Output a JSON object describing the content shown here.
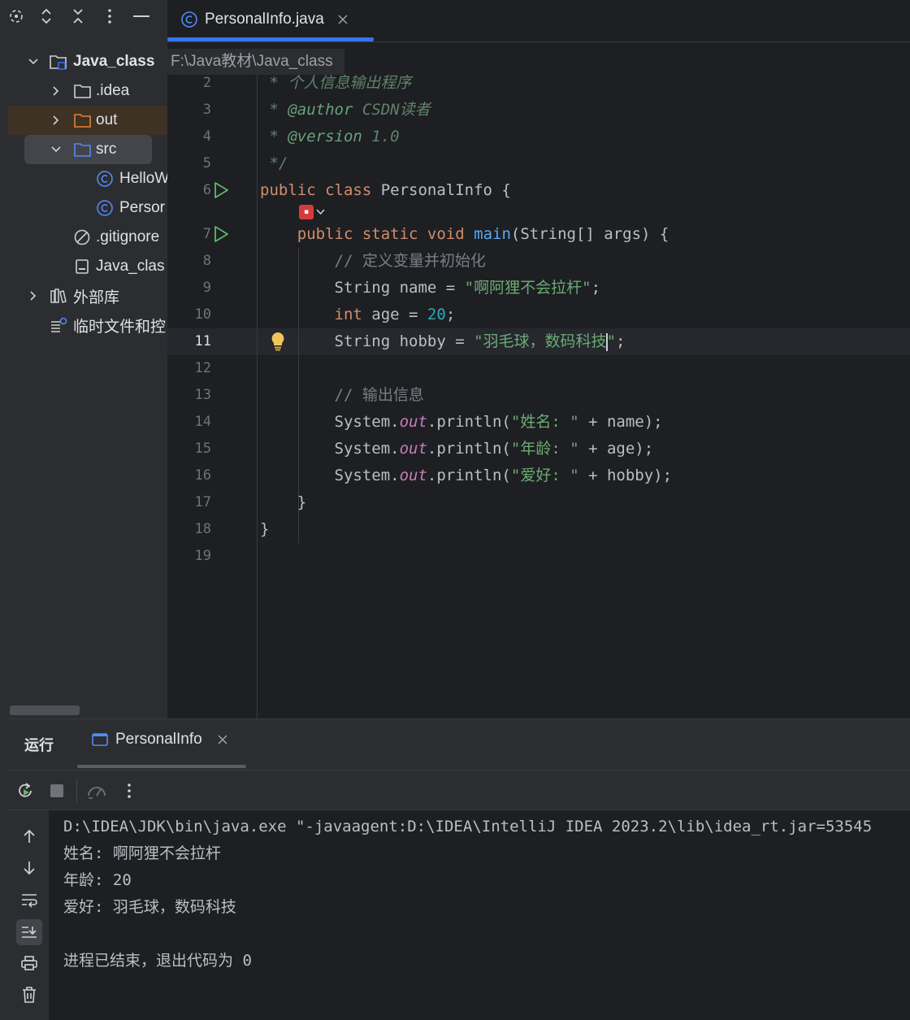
{
  "project": {
    "root_name": "Java_class",
    "root_path": "F:\\Java教材\\Java_class",
    "items": [
      {
        "label": ".idea"
      },
      {
        "label": "out"
      },
      {
        "label": "src"
      },
      {
        "label": "HelloW"
      },
      {
        "label": "Persor"
      },
      {
        "label": ".gitignore"
      },
      {
        "label": "Java_clas"
      },
      {
        "label": "外部库"
      },
      {
        "label": "临时文件和控"
      }
    ]
  },
  "editor": {
    "tab_label": "PersonalInfo.java",
    "line_numbers": [
      "2",
      "3",
      "4",
      "5",
      "6",
      "7",
      "8",
      "9",
      "10",
      "11",
      "12",
      "13",
      "14",
      "15",
      "16",
      "17",
      "18",
      "19"
    ],
    "current_line": "11",
    "code": {
      "l2": " * 个人信息输出程序",
      "l3_star": " * ",
      "l3_tag": "@author",
      "l3_val": " CSDN读者",
      "l4_star": " * ",
      "l4_tag": "@version",
      "l4_val": " 1.0",
      "l5": " */",
      "l6_kw": "public class",
      "l6_rest": " PersonalInfo {",
      "l7_kw": "public static void",
      "l7_fn": "main",
      "l7_rest": "(String[] args) {",
      "l8": "// 定义变量并初始化",
      "l9_pre": "String name = ",
      "l9_str": "\"啊阿狸不会拉杆\"",
      "l9_end": ";",
      "l10_kw": "int",
      "l10_mid": " age = ",
      "l10_num": "20",
      "l10_end": ";",
      "l11_pre": "String hobby = ",
      "l11_str_a": "\"羽毛球，数码科技",
      "l11_str_b": "\"",
      "l11_end": ";",
      "l13": "// 输出信息",
      "sys": "System.",
      "out": "out",
      "println": ".println(",
      "l14_str": "\"姓名: \"",
      "l14_rest": " + name);",
      "l15_str": "\"年龄: \"",
      "l15_rest": " + age);",
      "l16_str": "\"爱好: \"",
      "l16_rest": " + hobby);",
      "l17": "}",
      "l18": "}"
    }
  },
  "run": {
    "title": "运行",
    "tab_label": "PersonalInfo",
    "console_lines": [
      "D:\\IDEA\\JDK\\bin\\java.exe \"-javaagent:D:\\IDEA\\IntelliJ IDEA 2023.2\\lib\\idea_rt.jar=53545",
      "姓名: 啊阿狸不会拉杆",
      "年龄: 20",
      "爱好: 羽毛球，数码科技",
      "",
      "进程已结束，退出代码为 0"
    ]
  },
  "colors": {
    "accent": "#3574f0",
    "keyword": "#cf8e6d",
    "string": "#6aab73",
    "number": "#2aacb8",
    "function": "#56a8f5",
    "field": "#c77dbb",
    "run_green": "#5fb865"
  },
  "icons": [
    "target-icon",
    "expand-collapse-icon",
    "collapse-icon",
    "more-vertical-icon",
    "minimize-icon",
    "class-icon",
    "folder-icon",
    "module-icon",
    "gitignore-icon",
    "file-icon",
    "library-icon",
    "scratches-icon",
    "run-gutter-icon",
    "bulb-icon",
    "plugin-badge-icon",
    "rerun-icon",
    "stop-icon",
    "profiler-icon",
    "arrow-up-icon",
    "arrow-down-icon",
    "soft-wrap-icon",
    "scroll-end-icon",
    "print-icon",
    "trash-icon"
  ]
}
